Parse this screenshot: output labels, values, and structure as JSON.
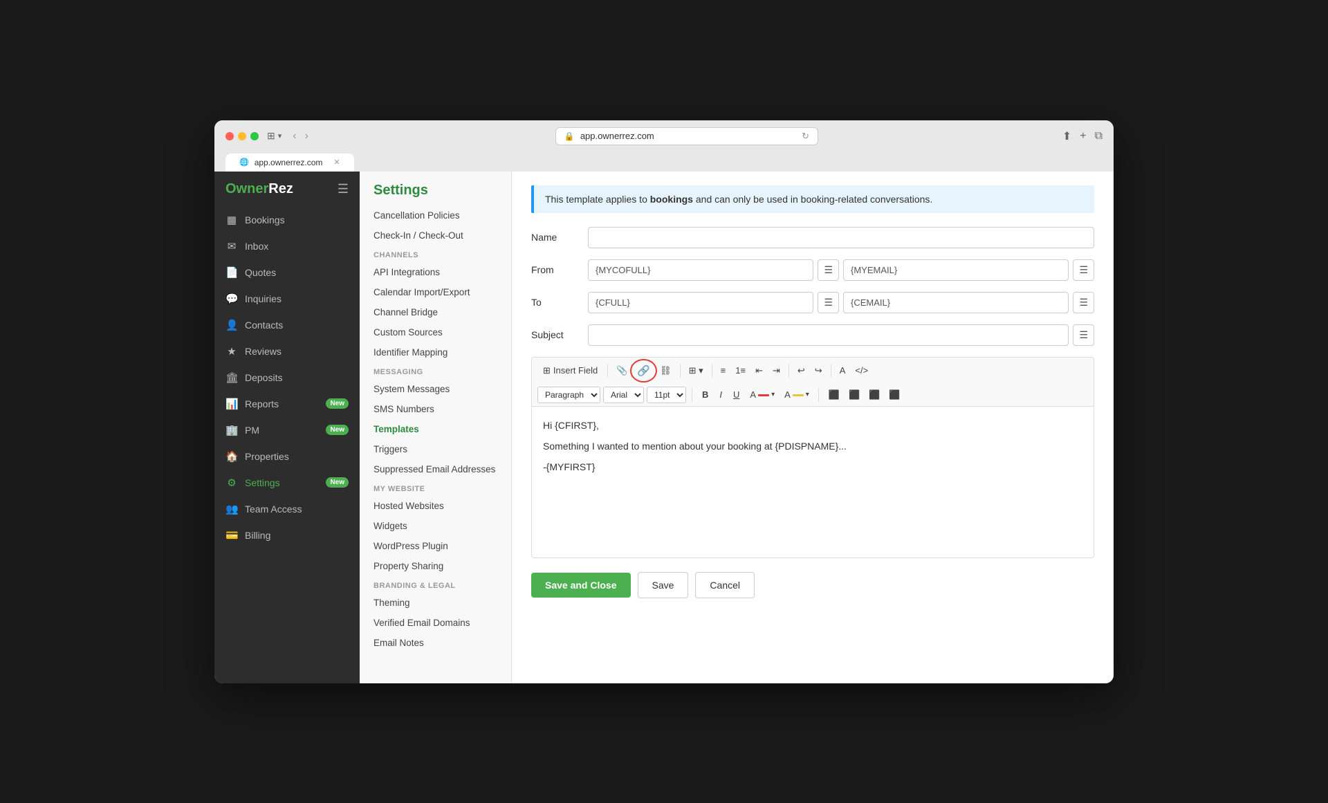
{
  "browser": {
    "url": "app.ownerrez.com",
    "tab_label": "app.ownerrez.com"
  },
  "logo": {
    "brand": "OwnerRez"
  },
  "sidebar": {
    "items": [
      {
        "id": "bookings",
        "label": "Bookings",
        "icon": "📅",
        "badge": null
      },
      {
        "id": "inbox",
        "label": "Inbox",
        "icon": "✉️",
        "badge": null
      },
      {
        "id": "quotes",
        "label": "Quotes",
        "icon": "📄",
        "badge": null
      },
      {
        "id": "inquiries",
        "label": "Inquiries",
        "icon": "💬",
        "badge": null
      },
      {
        "id": "contacts",
        "label": "Contacts",
        "icon": "👤",
        "badge": null
      },
      {
        "id": "reviews",
        "label": "Reviews",
        "icon": "⭐",
        "badge": null
      },
      {
        "id": "deposits",
        "label": "Deposits",
        "icon": "🏦",
        "badge": null
      },
      {
        "id": "reports",
        "label": "Reports",
        "icon": "📊",
        "badge": "New"
      },
      {
        "id": "pm",
        "label": "PM",
        "icon": "🏢",
        "badge": "New"
      }
    ],
    "bottom_items": [
      {
        "id": "properties",
        "label": "Properties",
        "icon": "🏠"
      },
      {
        "id": "settings",
        "label": "Settings",
        "icon": "⚙️",
        "badge": "New"
      },
      {
        "id": "team-access",
        "label": "Team Access",
        "icon": "👥"
      },
      {
        "id": "billing",
        "label": "Billing",
        "icon": "💳"
      }
    ]
  },
  "settings_nav": {
    "header": "Settings",
    "sections": [
      {
        "label": null,
        "items": [
          {
            "label": "Cancellation Policies",
            "active": false
          },
          {
            "label": "Check-In / Check-Out",
            "active": false
          }
        ]
      },
      {
        "label": "Channels",
        "items": [
          {
            "label": "API Integrations",
            "active": false
          },
          {
            "label": "Calendar Import/Export",
            "active": false
          },
          {
            "label": "Channel Bridge",
            "active": false
          },
          {
            "label": "Custom Sources",
            "active": false
          },
          {
            "label": "Identifier Mapping",
            "active": false
          }
        ]
      },
      {
        "label": "Messaging",
        "items": [
          {
            "label": "System Messages",
            "active": false
          },
          {
            "label": "SMS Numbers",
            "active": false
          },
          {
            "label": "Templates",
            "active": true
          },
          {
            "label": "Triggers",
            "active": false
          },
          {
            "label": "Suppressed Email Addresses",
            "active": false
          }
        ]
      },
      {
        "label": "My Website",
        "items": [
          {
            "label": "Hosted Websites",
            "active": false
          },
          {
            "label": "Widgets",
            "active": false
          },
          {
            "label": "WordPress Plugin",
            "active": false
          },
          {
            "label": "Property Sharing",
            "active": false
          }
        ]
      },
      {
        "label": "Branding & Legal",
        "items": [
          {
            "label": "Theming",
            "active": false
          },
          {
            "label": "Verified Email Domains",
            "active": false
          },
          {
            "label": "Email Notes",
            "active": false
          }
        ]
      }
    ]
  },
  "main": {
    "info_banner": "This template applies to bookings and can only be used in booking-related conversations.",
    "info_banner_bold": "bookings",
    "form": {
      "name_label": "Name",
      "name_placeholder": "",
      "from_label": "From",
      "from_value": "{MYCOFULL}",
      "from_email": "{MYEMAIL}",
      "to_label": "To",
      "to_value": "{CFULL}",
      "to_email": "{CEMAIL}",
      "subject_label": "Subject",
      "subject_value": ""
    },
    "toolbar": {
      "insert_field": "Insert Field",
      "paragraph_label": "Paragraph",
      "font_label": "Arial",
      "size_label": "11pt"
    },
    "editor": {
      "line1": "Hi {CFIRST},",
      "line2": "Something I wanted to mention about your booking at {PDISPNAME}...",
      "line3": "-{MYFIRST}"
    },
    "actions": {
      "save_close": "Save and Close",
      "save": "Save",
      "cancel": "Cancel"
    }
  }
}
